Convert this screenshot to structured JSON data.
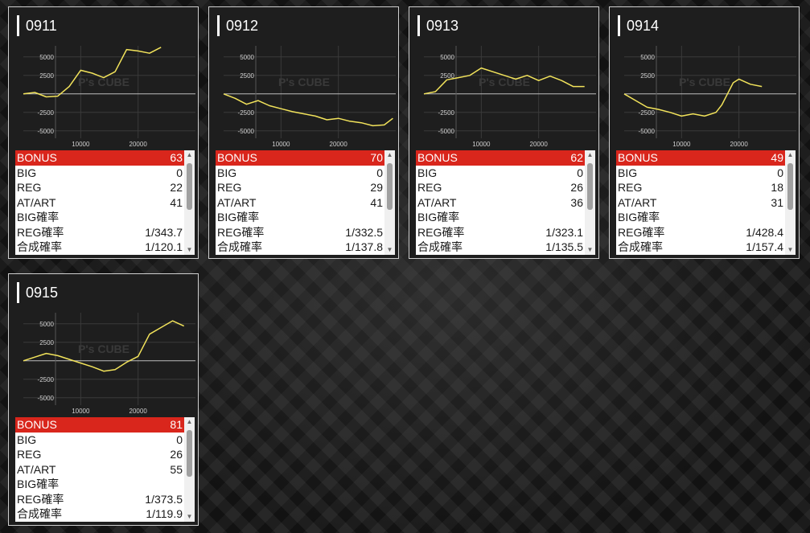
{
  "colors": {
    "line": "#f2e35b",
    "highlight": "#d9261c"
  },
  "labels": [
    "BONUS",
    "BIG",
    "REG",
    "AT/ART",
    "BIG確率",
    "REG確率",
    "合成確率"
  ],
  "watermark": {
    "logo": "P's CUBE"
  },
  "icons": {
    "up": "scroll-up-arrow",
    "down": "scroll-down-arrow"
  },
  "machines": [
    {
      "name": "0911",
      "bonus": "63",
      "big": "0",
      "reg": "22",
      "at_art": "41",
      "big_rate": "",
      "reg_rate": "1/343.7",
      "total_rate": "1/120.1"
    },
    {
      "name": "0912",
      "bonus": "70",
      "big": "0",
      "reg": "29",
      "at_art": "41",
      "big_rate": "",
      "reg_rate": "1/332.5",
      "total_rate": "1/137.8"
    },
    {
      "name": "0913",
      "bonus": "62",
      "big": "0",
      "reg": "26",
      "at_art": "36",
      "big_rate": "",
      "reg_rate": "1/323.1",
      "total_rate": "1/135.5"
    },
    {
      "name": "0914",
      "bonus": "49",
      "big": "0",
      "reg": "18",
      "at_art": "31",
      "big_rate": "",
      "reg_rate": "1/428.4",
      "total_rate": "1/157.4"
    },
    {
      "name": "0915",
      "bonus": "81",
      "big": "0",
      "reg": "26",
      "at_art": "55",
      "big_rate": "",
      "reg_rate": "1/373.5",
      "total_rate": "1/119.9"
    }
  ],
  "chart_data": [
    {
      "type": "line",
      "xticks": [
        "10000",
        "20000"
      ],
      "yticks": [
        "5000",
        "2500",
        "-2500",
        "-5000"
      ],
      "ylim": [
        -6000,
        6500
      ],
      "x": [
        0,
        2000,
        4000,
        6000,
        8000,
        10000,
        12000,
        14000,
        16000,
        18000,
        20000,
        22000,
        24000
      ],
      "y": [
        0,
        200,
        -400,
        -300,
        1000,
        3200,
        2800,
        2200,
        3000,
        6000,
        5800,
        5500,
        6300
      ]
    },
    {
      "type": "line",
      "xticks": [
        "10000",
        "20000"
      ],
      "yticks": [
        "5000",
        "2500",
        "-2500",
        "-5000"
      ],
      "ylim": [
        -6000,
        6500
      ],
      "x": [
        0,
        2000,
        4000,
        6000,
        8000,
        10000,
        12000,
        14000,
        16000,
        18000,
        20000,
        22000,
        24000,
        26000,
        28000,
        29500
      ],
      "y": [
        0,
        -600,
        -1400,
        -900,
        -1600,
        -2000,
        -2400,
        -2700,
        -3000,
        -3500,
        -3300,
        -3700,
        -3900,
        -4300,
        -4200,
        -3300
      ]
    },
    {
      "type": "line",
      "xticks": [
        "10000",
        "20000"
      ],
      "yticks": [
        "5000",
        "2500",
        "-2500",
        "-5000"
      ],
      "ylim": [
        -6000,
        6500
      ],
      "x": [
        0,
        2000,
        4000,
        6000,
        8000,
        10000,
        12000,
        14000,
        16000,
        18000,
        20000,
        22000,
        24000,
        26000,
        28000
      ],
      "y": [
        0,
        300,
        1900,
        2200,
        2500,
        3500,
        3000,
        2500,
        2000,
        2500,
        1800,
        2400,
        1800,
        1000,
        1000
      ]
    },
    {
      "type": "line",
      "xticks": [
        "10000",
        "20000"
      ],
      "yticks": [
        "5000",
        "2500",
        "-2500",
        "-5000"
      ],
      "ylim": [
        -6000,
        6500
      ],
      "x": [
        0,
        2000,
        4000,
        6000,
        8000,
        10000,
        12000,
        14000,
        16000,
        17000,
        18000,
        19000,
        20000,
        22000,
        24000
      ],
      "y": [
        0,
        -900,
        -1800,
        -2100,
        -2500,
        -3000,
        -2700,
        -3000,
        -2500,
        -1500,
        0,
        1500,
        2000,
        1300,
        1000
      ]
    },
    {
      "type": "line",
      "xticks": [
        "10000",
        "20000"
      ],
      "yticks": [
        "5000",
        "2500",
        "-2500",
        "-5000"
      ],
      "ylim": [
        -6000,
        6500
      ],
      "x": [
        0,
        2000,
        4000,
        6000,
        8000,
        10000,
        12000,
        14000,
        16000,
        18000,
        20000,
        22000,
        24000,
        26000,
        28000
      ],
      "y": [
        0,
        500,
        1000,
        700,
        200,
        -300,
        -800,
        -1400,
        -1200,
        -200,
        600,
        3600,
        4500,
        5400,
        4700
      ]
    }
  ]
}
